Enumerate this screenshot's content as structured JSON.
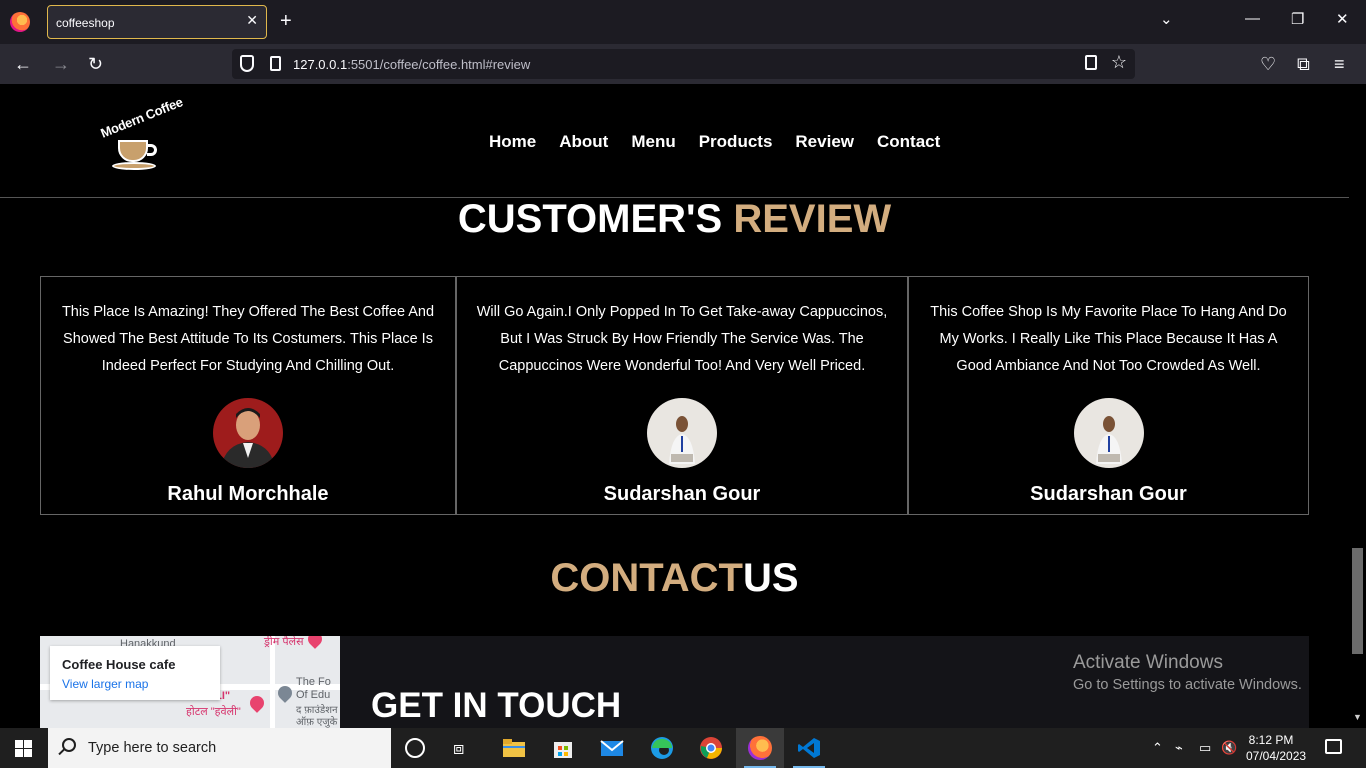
{
  "browser": {
    "tab_title": "coffeeshop",
    "tab_close": "✕",
    "new_tab": "+",
    "url_host": "127.0.0.1",
    "url_rest": ":5501/coffee/coffee.html#review"
  },
  "site": {
    "logo_text": "Modern Coffee",
    "nav": [
      "Home",
      "About",
      "Menu",
      "Products",
      "Review",
      "Contact"
    ]
  },
  "review_section": {
    "title_main": "CUSTOMER'S",
    "title_accent": "REVIEW",
    "cards": [
      {
        "quote": "This Place Is Amazing! They Offered The Best Coffee And Showed The Best Attitude To Its Costumers. This Place Is Indeed Perfect For Studying And Chilling Out.",
        "name": "Rahul Morchhale"
      },
      {
        "quote": "Will Go Again.I Only Popped In To Get Take-away Cappuccinos, But I Was Struck By How Friendly The Service Was. The Cappuccinos Were Wonderful Too! And Very Well Priced.",
        "name": "Sudarshan Gour"
      },
      {
        "quote": "This Coffee Shop Is My Favorite Place To Hang And Do My Works. I Really Like This Place Because It Has A Good Ambiance And Not Too Crowded As Well.",
        "name": "Sudarshan Gour"
      }
    ]
  },
  "contact_section": {
    "title_accent": "CONTACT",
    "title_main": "US",
    "map": {
      "place_name": "Coffee House cafe",
      "larger_map_link": "View larger map",
      "labels": [
        "Hanakkund",
        "ड्रीम पैलेस",
        "HOTEL \"HAVELI\"",
        "होटल \"हवेली\"",
        "The Fo",
        "Of Edu",
        "द फ़ाउंडेशन",
        "ऑफ़ एजुके"
      ]
    },
    "get_in_touch": "GET IN TOUCH"
  },
  "watermark": {
    "line1": "Activate Windows",
    "line2": "Go to Settings to activate Windows."
  },
  "taskbar": {
    "search_placeholder": "Type here to search",
    "time": "8:12 PM",
    "date": "07/04/2023"
  },
  "colors": {
    "accent": "#d3ad7f",
    "page_bg": "#000000",
    "browser_tabbar": "#1c1b22",
    "browser_toolbar": "#2b2a33",
    "taskbar": "#1f1f1f"
  }
}
